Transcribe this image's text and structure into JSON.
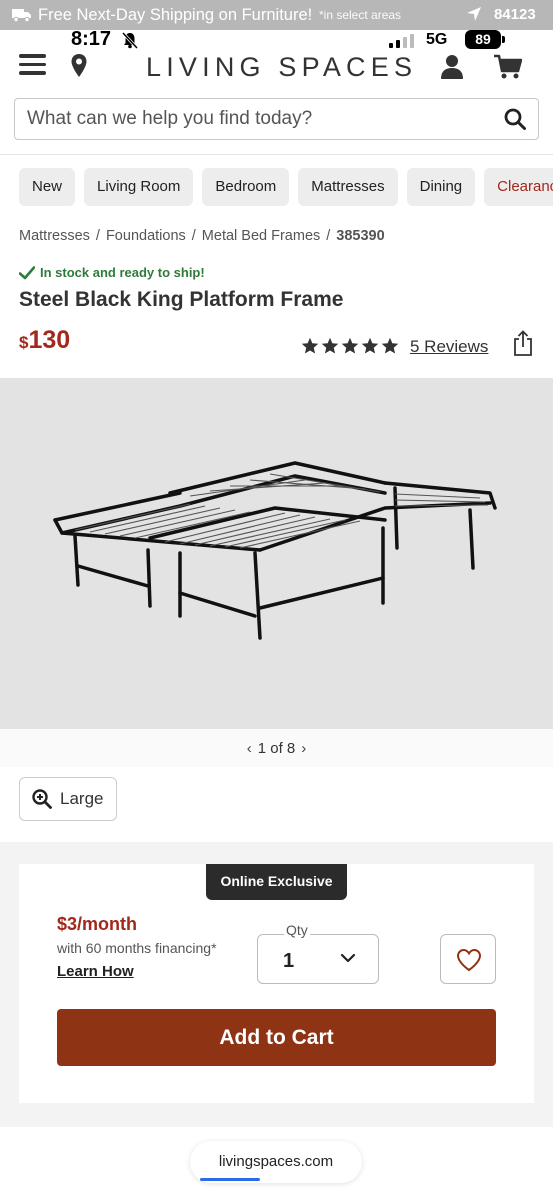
{
  "promo": {
    "text": "Free Next-Day Shipping on Furniture!",
    "note": "*in select areas",
    "zip": "84123"
  },
  "status_bar": {
    "time": "8:17",
    "network": "5G",
    "battery": "89"
  },
  "header": {
    "logo": "LIVING SPACES"
  },
  "search": {
    "placeholder": "What can we help you find today?"
  },
  "categories": [
    "New",
    "Living Room",
    "Bedroom",
    "Mattresses",
    "Dining",
    "Clearance"
  ],
  "breadcrumb": [
    "Mattresses",
    "Foundations",
    "Metal Bed Frames",
    "385390"
  ],
  "product": {
    "stock_status": "In stock and ready to ship!",
    "title": "Steel Black King Platform Frame",
    "currency": "$",
    "price": "130",
    "rating": 5,
    "reviews": "5 Reviews"
  },
  "gallery": {
    "page_label": "1 of 8",
    "large_label": "Large"
  },
  "purchase": {
    "badge": "Online Exclusive",
    "monthly": "$3/month",
    "financing": "with 60 months financing*",
    "learn_how": "Learn How",
    "qty_label": "Qty",
    "qty_value": "1",
    "add_to_cart": "Add to Cart"
  },
  "browser": {
    "url": "livingspaces.com"
  },
  "colors": {
    "accent_red": "#a2281b",
    "cart_button": "#8e3414",
    "stock_green": "#2f7b3a"
  }
}
